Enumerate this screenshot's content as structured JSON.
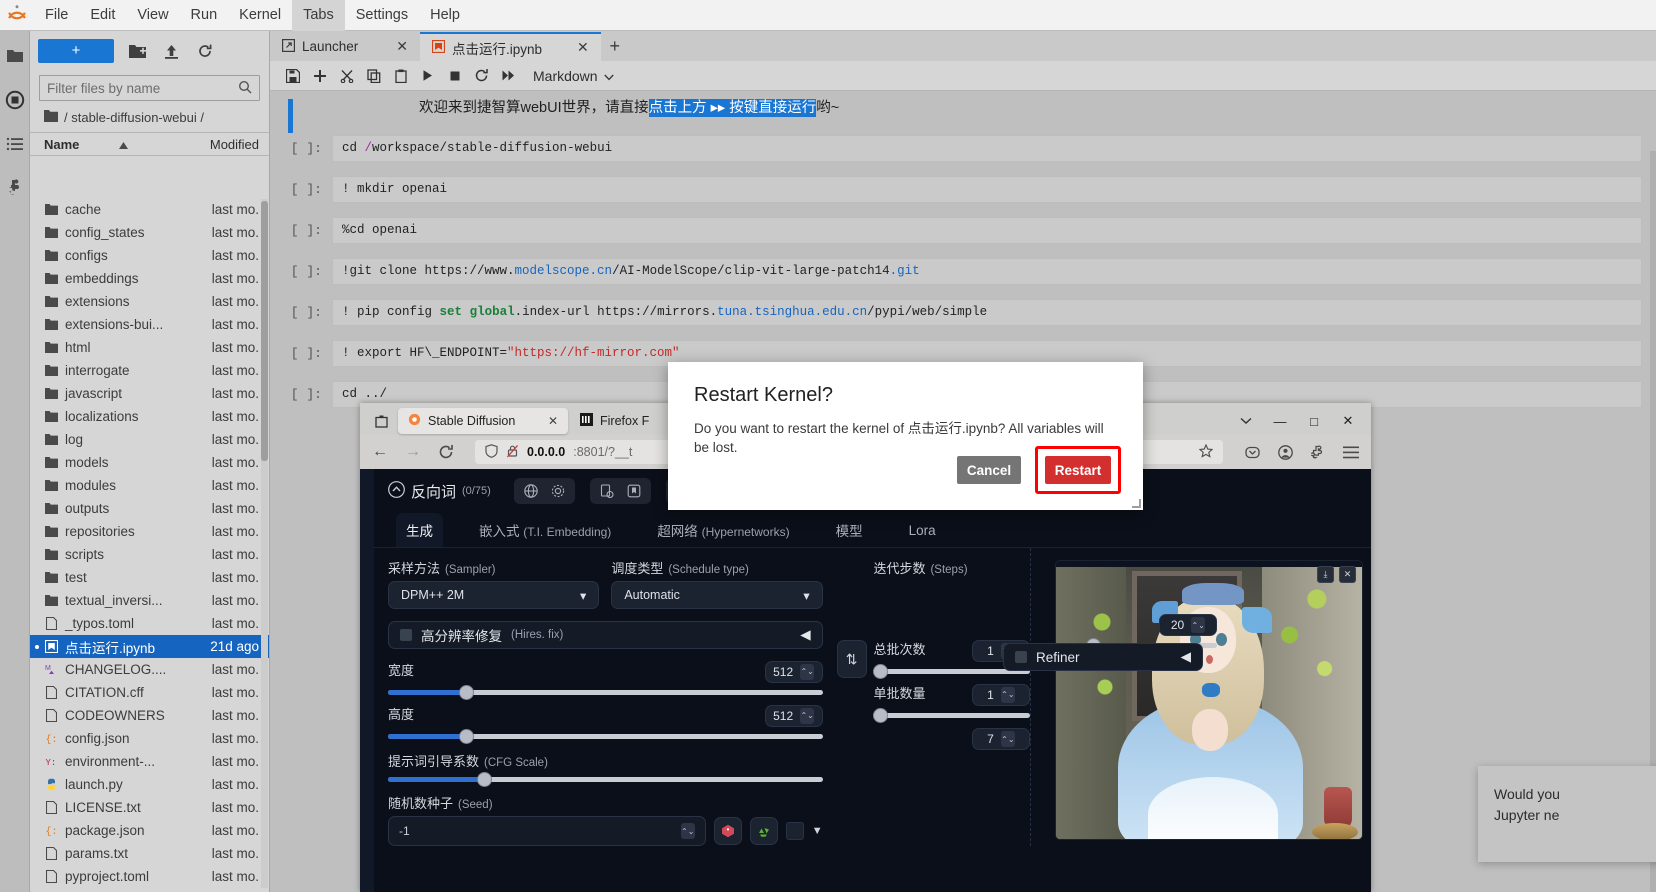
{
  "app": {
    "menu": [
      "File",
      "Edit",
      "View",
      "Run",
      "Kernel",
      "Tabs",
      "Settings",
      "Help"
    ],
    "active_menu": "Tabs"
  },
  "sidebar": {
    "new_button_label": "+",
    "filter_placeholder": "Filter files by name",
    "breadcrumb": "/ stable-diffusion-webui /",
    "columns": [
      "Name",
      "Modified"
    ],
    "items": [
      {
        "name": "cache",
        "modified": "last mo.",
        "type": "folder"
      },
      {
        "name": "config_states",
        "modified": "last mo.",
        "type": "folder"
      },
      {
        "name": "configs",
        "modified": "last mo.",
        "type": "folder"
      },
      {
        "name": "embeddings",
        "modified": "last mo.",
        "type": "folder"
      },
      {
        "name": "extensions",
        "modified": "last mo.",
        "type": "folder"
      },
      {
        "name": "extensions-bui...",
        "modified": "last mo.",
        "type": "folder"
      },
      {
        "name": "html",
        "modified": "last mo.",
        "type": "folder"
      },
      {
        "name": "interrogate",
        "modified": "last mo.",
        "type": "folder"
      },
      {
        "name": "javascript",
        "modified": "last mo.",
        "type": "folder"
      },
      {
        "name": "localizations",
        "modified": "last mo.",
        "type": "folder"
      },
      {
        "name": "log",
        "modified": "last mo.",
        "type": "folder"
      },
      {
        "name": "models",
        "modified": "last mo.",
        "type": "folder"
      },
      {
        "name": "modules",
        "modified": "last mo.",
        "type": "folder"
      },
      {
        "name": "outputs",
        "modified": "last mo.",
        "type": "folder"
      },
      {
        "name": "repositories",
        "modified": "last mo.",
        "type": "folder"
      },
      {
        "name": "scripts",
        "modified": "last mo.",
        "type": "folder"
      },
      {
        "name": "test",
        "modified": "last mo.",
        "type": "folder"
      },
      {
        "name": "textual_inversi...",
        "modified": "last mo.",
        "type": "folder"
      },
      {
        "name": "_typos.toml",
        "modified": "last mo.",
        "type": "file"
      },
      {
        "name": "点击运行.ipynb",
        "modified": "21d ago",
        "type": "notebook",
        "selected": true,
        "running": true
      },
      {
        "name": "CHANGELOG....",
        "modified": "last mo.",
        "type": "markdown"
      },
      {
        "name": "CITATION.cff",
        "modified": "last mo.",
        "type": "file"
      },
      {
        "name": "CODEOWNERS",
        "modified": "last mo.",
        "type": "file"
      },
      {
        "name": "config.json",
        "modified": "last mo.",
        "type": "json"
      },
      {
        "name": "environment-...",
        "modified": "last mo.",
        "type": "yaml"
      },
      {
        "name": "launch.py",
        "modified": "last mo.",
        "type": "python"
      },
      {
        "name": "LICENSE.txt",
        "modified": "last mo.",
        "type": "file"
      },
      {
        "name": "package.json",
        "modified": "last mo.",
        "type": "json"
      },
      {
        "name": "params.txt",
        "modified": "last mo.",
        "type": "file"
      },
      {
        "name": "pyproject.toml",
        "modified": "last mo.",
        "type": "file"
      }
    ]
  },
  "tabs": [
    {
      "label": "Launcher",
      "active": false
    },
    {
      "label": "点击运行.ipynb",
      "active": true
    }
  ],
  "notebook": {
    "toolbar_celltype": "Markdown",
    "markdown_cell": {
      "before": "欢迎来到捷智算webUI世界，请直接",
      "selected": "点击上方 ▸▸ 按键直接运行",
      "after": "哟~"
    },
    "cells": [
      {
        "prompt": "[ ]:",
        "source": "cd /workspace/stable-diffusion-webui"
      },
      {
        "prompt": "[ ]:",
        "source": "! mkdir openai"
      },
      {
        "prompt": "[ ]:",
        "source": "%cd openai"
      },
      {
        "prompt": "[ ]:",
        "source": "!git clone https://www.modelscope.cn/AI-ModelScope/clip-vit-large-patch14.git"
      },
      {
        "prompt": "[ ]:",
        "source": "! pip config set global.index-url https://mirrors.tuna.tsinghua.edu.cn/pypi/web/simple"
      },
      {
        "prompt": "[ ]:",
        "source": "! export HF\\_ENDPOINT=\"https://hf-mirror.com\""
      },
      {
        "prompt": "[ ]:",
        "source": "cd ../"
      }
    ]
  },
  "dialog": {
    "title": "Restart Kernel?",
    "message": "Do you want to restart the kernel of 点击运行.ipynb? All variables will be lost.",
    "cancel_label": "Cancel",
    "restart_label": "Restart",
    "highlight_color": "#ff0000"
  },
  "toast": {
    "line1": "Would you",
    "line2": "Jupyter ne"
  },
  "browser": {
    "tabs": [
      {
        "title": "Stable Diffusion",
        "active": true
      },
      {
        "title": "Firefox F",
        "active": false
      }
    ],
    "url_host": "0.0.0.0",
    "url_port": ":8801/?__t",
    "window_buttons": [
      "—",
      "□",
      "✕"
    ]
  },
  "sd_webui": {
    "negative_prompt_title": "反向词",
    "negative_prompt_count": "(0/75)",
    "tabs": [
      {
        "cn": "生成",
        "en": "",
        "active": true
      },
      {
        "cn": "嵌入式",
        "en": "(T.I. Embedding)",
        "active": false
      },
      {
        "cn": "超网络",
        "en": "(Hypernetworks)",
        "active": false
      },
      {
        "cn": "模型",
        "en": "",
        "active": false
      },
      {
        "cn": "Lora",
        "en": "",
        "active": false
      }
    ],
    "sampler": {
      "label_cn": "采样方法",
      "label_en": "(Sampler)",
      "value": "DPM++ 2M"
    },
    "schedule": {
      "label_cn": "调度类型",
      "label_en": "(Schedule type)",
      "value": "Automatic"
    },
    "steps": {
      "label_cn": "迭代步数",
      "label_en": "(Steps)",
      "value": "20",
      "percent": 17
    },
    "hires": {
      "label_cn": "高分辨率修复",
      "label_en": "(Hires. fix)",
      "checked": false
    },
    "refiner": {
      "label": "Refiner",
      "checked": false
    },
    "width": {
      "label_cn": "宽度",
      "value": "512",
      "percent": 18
    },
    "height": {
      "label_cn": "高度",
      "value": "512",
      "percent": 18
    },
    "batch_count": {
      "label_cn": "总批次数",
      "value": "1",
      "percent": 2
    },
    "batch_size": {
      "label_cn": "单批数量",
      "value": "1",
      "percent": 2
    },
    "cfg_scale": {
      "label_cn": "提示词引导系数",
      "label_en": "(CFG Scale)",
      "value": "7",
      "percent": 22
    },
    "seed": {
      "label_cn": "随机数种子",
      "label_en": "(Seed)",
      "value": "-1"
    }
  }
}
